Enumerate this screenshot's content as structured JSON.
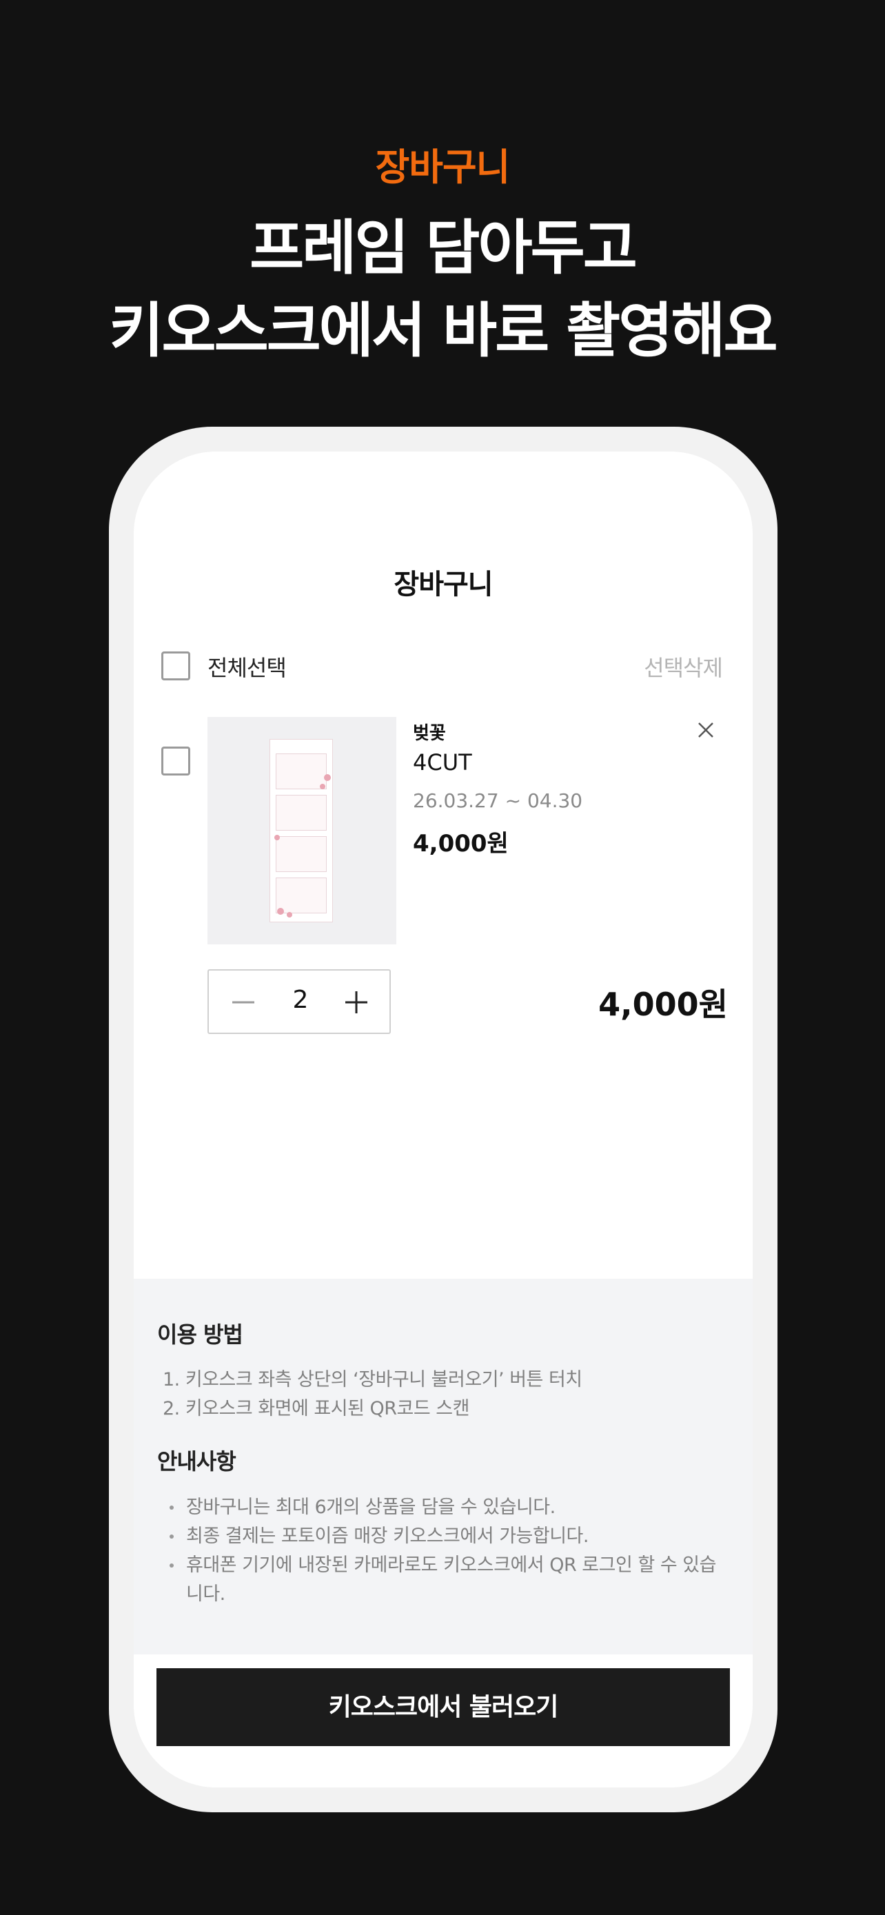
{
  "promo": {
    "eyebrow": "장바구니",
    "headline_line1": "프레임 담아두고",
    "headline_line2": "키오스크에서 바로 촬영해요"
  },
  "cart": {
    "title": "장바구니",
    "select_all_label": "전체선택",
    "delete_selected_label": "선택삭제",
    "items": [
      {
        "brand": "벚꽃",
        "name": "4CUT",
        "period": "26.03.27 ~ 04.30",
        "price": "4,000원",
        "quantity": "2",
        "line_total": "4,000원"
      }
    ]
  },
  "info": {
    "usage_heading": "이용 방법",
    "usage_steps": [
      "1. 키오스크 좌측 상단의 ‘장바구니 불러오기’ 버튼 터치",
      "2. 키오스크 화면에 표시된 QR코드 스캔"
    ],
    "notice_heading": "안내사항",
    "notices": [
      "장바구니는 최대 6개의 상품을 담을 수 있습니다.",
      "최종 결제는 포토이즘 매장 키오스크에서 가능합니다.",
      "휴대폰 기기에 내장된 카메라로도 키오스크에서 QR 로그인 할 수 있습",
      "니다."
    ]
  },
  "cta": {
    "label": "키오스크에서 불러오기"
  },
  "colors": {
    "background": "#121212",
    "accent": "#F26B0F",
    "button": "#1C1C1C",
    "info_panel": "#F3F4F6"
  }
}
